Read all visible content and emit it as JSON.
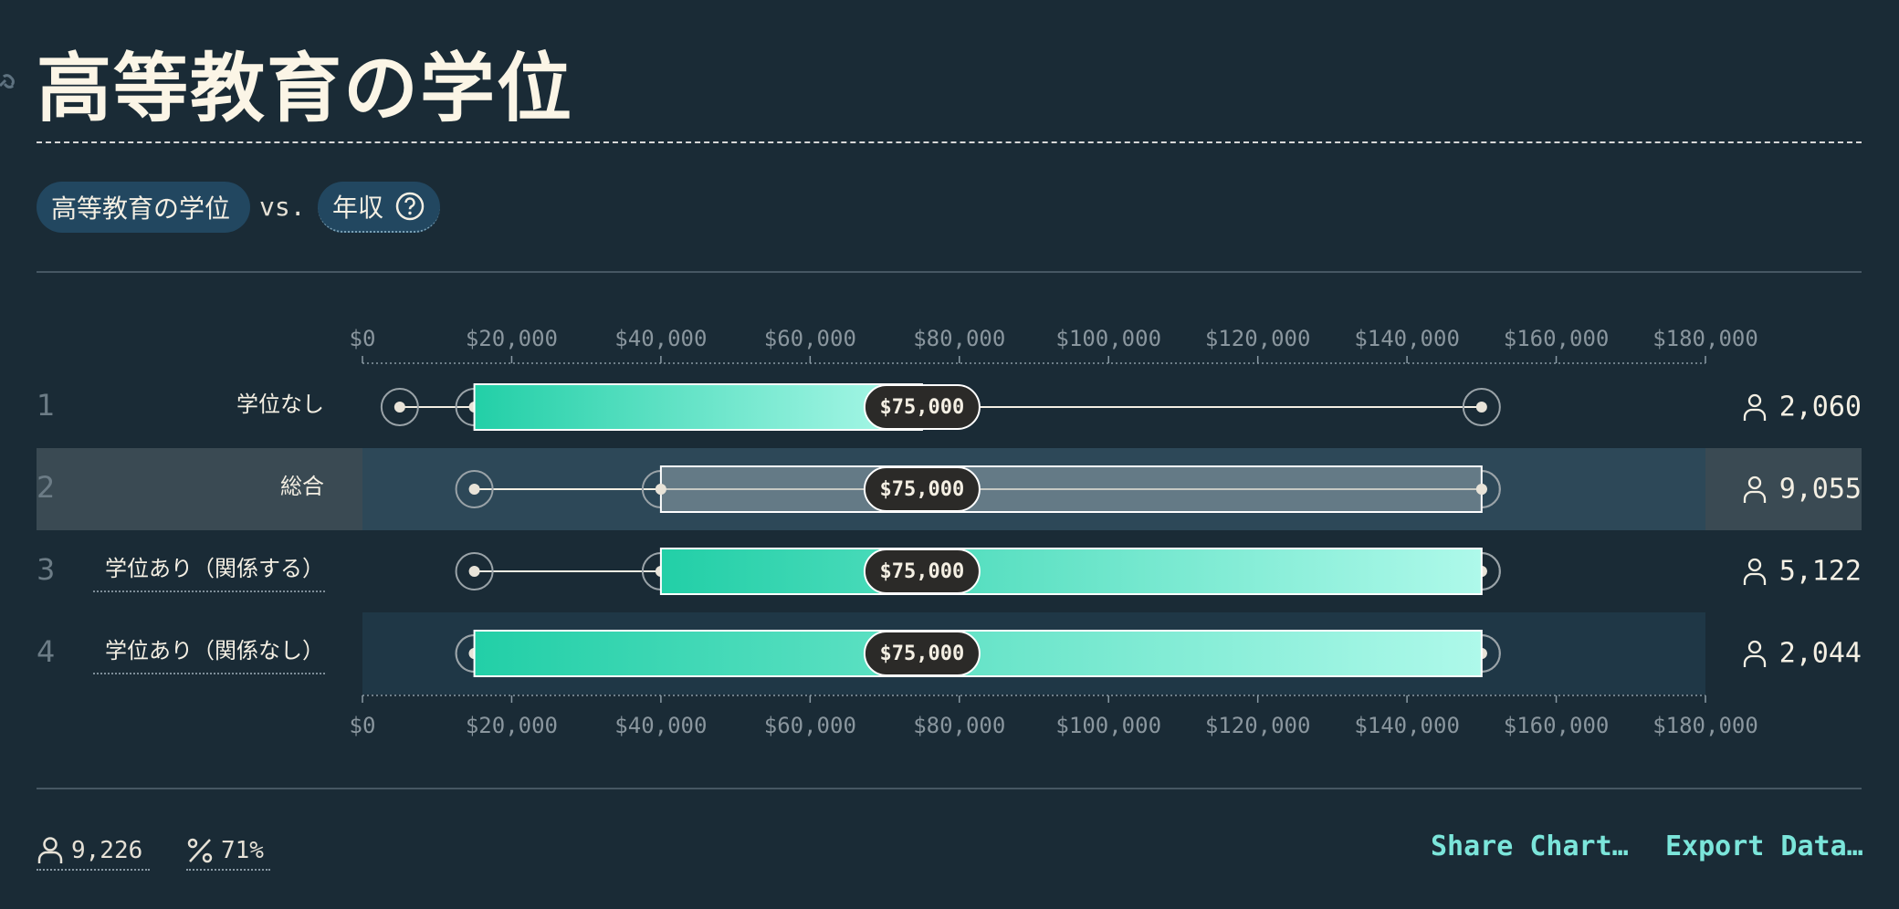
{
  "title": "高等教育の学位",
  "selector": {
    "x_label": "高等教育の学位",
    "vs": "vs.",
    "y_label": "年収"
  },
  "chart_data": {
    "type": "box",
    "axis": {
      "min": 0,
      "max": 180000,
      "ticks": [
        "$0",
        "$20,000",
        "$40,000",
        "$60,000",
        "$80,000",
        "$100,000",
        "$120,000",
        "$140,000",
        "$160,000",
        "$180,000"
      ]
    },
    "rows": [
      {
        "rank": "1",
        "label": "学位なし",
        "min": 5000,
        "q1": 15000,
        "median": 75000,
        "q3": 75000,
        "max": 150000,
        "median_label": "$75,000",
        "count": "2,060",
        "style": "teal",
        "underline": false
      },
      {
        "rank": "2",
        "label": "総合",
        "min": 15000,
        "q1": 40000,
        "median": 75000,
        "q3": 150000,
        "max": 150000,
        "median_label": "$75,000",
        "count": "9,055",
        "style": "gray",
        "underline": false
      },
      {
        "rank": "3",
        "label": "学位あり（関係する）",
        "min": 15000,
        "q1": 40000,
        "median": 75000,
        "q3": 150000,
        "max": 150000,
        "median_label": "$75,000",
        "count": "5,122",
        "style": "teal",
        "underline": true
      },
      {
        "rank": "4",
        "label": "学位あり（関係なし）",
        "min": 15000,
        "q1": 15000,
        "median": 75000,
        "q3": 150000,
        "max": 150000,
        "median_label": "$75,000",
        "count": "2,044",
        "style": "teal",
        "underline": true
      }
    ],
    "colors": {
      "teal_start": "#22cfa7",
      "teal_end": "#aef9ea",
      "overall_box": "#647a86",
      "median_pill": "#2b2a28",
      "highlight_row": "#3a4a53",
      "highlight_band": "#2d4858",
      "stripe_band": "#1f3746"
    }
  },
  "footer": {
    "total": "9,226",
    "percent": "71%",
    "share_label": "Share Chart…",
    "export_label": "Export Data…"
  }
}
